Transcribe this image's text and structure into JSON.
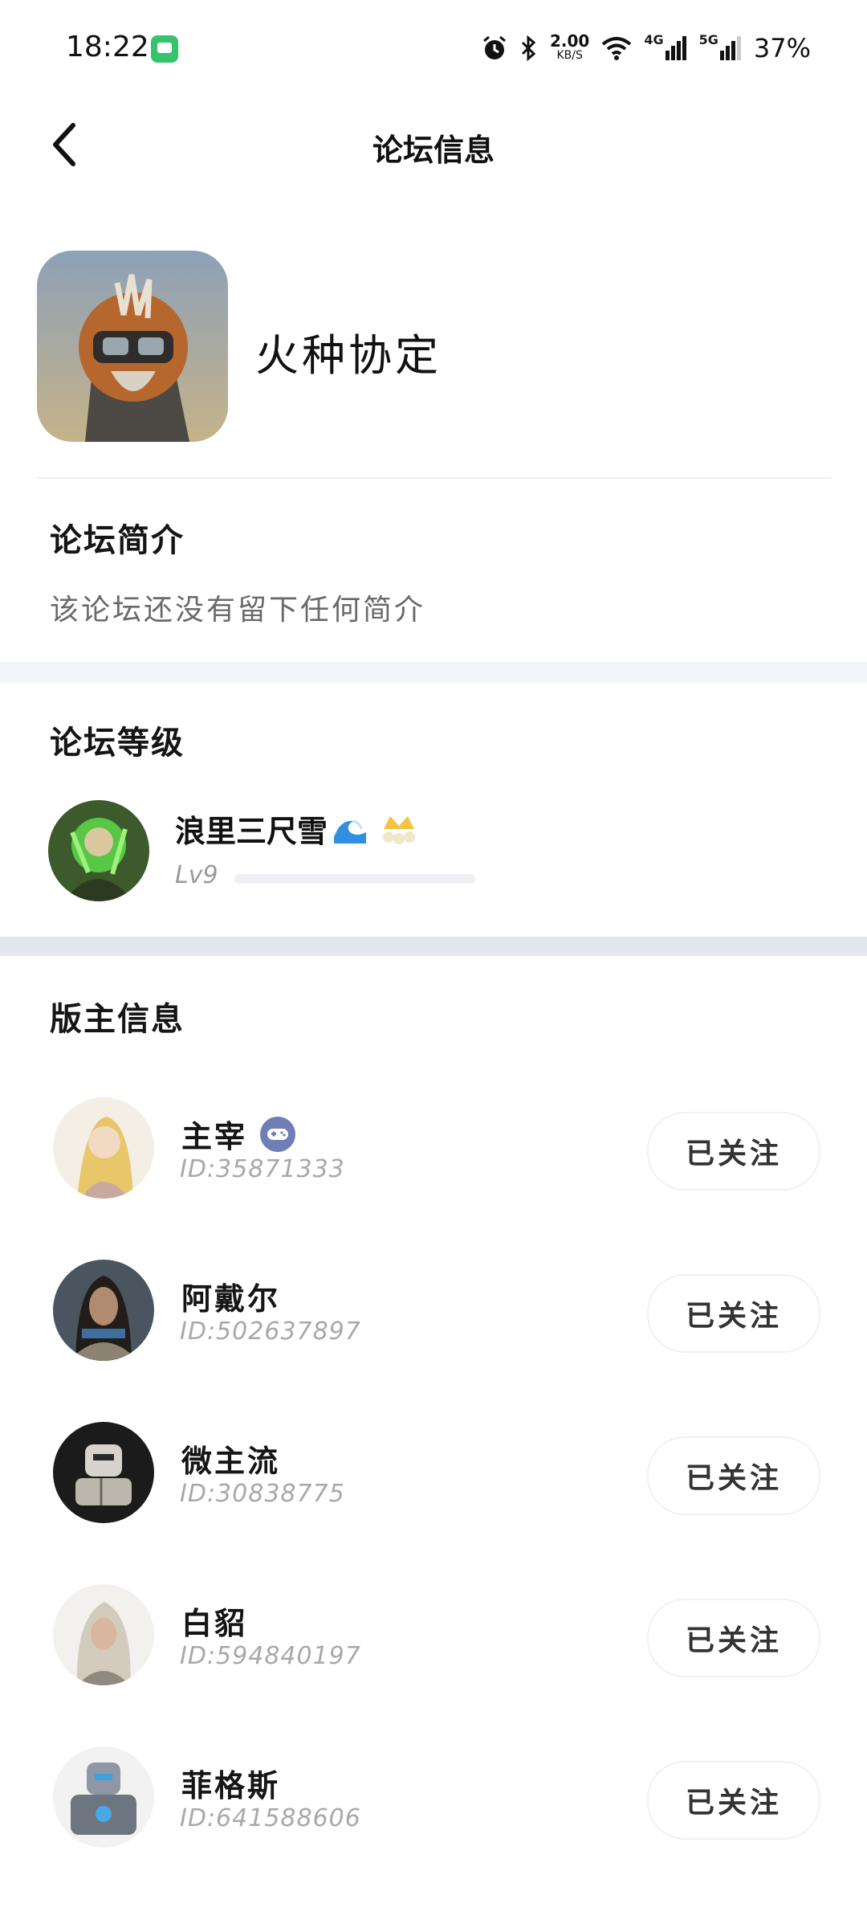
{
  "status_bar": {
    "time": "18:22",
    "speed_value": "2.00",
    "speed_unit": "KB/S",
    "network_1": "4G",
    "network_2": "5G",
    "battery": "37%"
  },
  "header": {
    "title": "论坛信息"
  },
  "forum": {
    "name": "火种协定"
  },
  "intro": {
    "title": "论坛简介",
    "text": "该论坛还没有留下任何简介"
  },
  "level": {
    "title": "论坛等级",
    "user_name": "浪里三尺雪",
    "level_label": "Lv9",
    "progress": 0.0
  },
  "moderators": {
    "title": "版主信息",
    "follow_label": "已关注",
    "items": [
      {
        "name": "主宰",
        "id": "ID:35871333",
        "has_badge": true
      },
      {
        "name": "阿戴尔",
        "id": "ID:502637897",
        "has_badge": false
      },
      {
        "name": "微主流",
        "id": "ID:30838775",
        "has_badge": false
      },
      {
        "name": "白貂",
        "id": "ID:594840197",
        "has_badge": false
      },
      {
        "name": "菲格斯",
        "id": "ID:641588606",
        "has_badge": false
      }
    ]
  },
  "colors": {
    "accent_green": "#35c46b",
    "badge_blue": "#6f7fb5",
    "section_gap": "#f3f5f8"
  }
}
